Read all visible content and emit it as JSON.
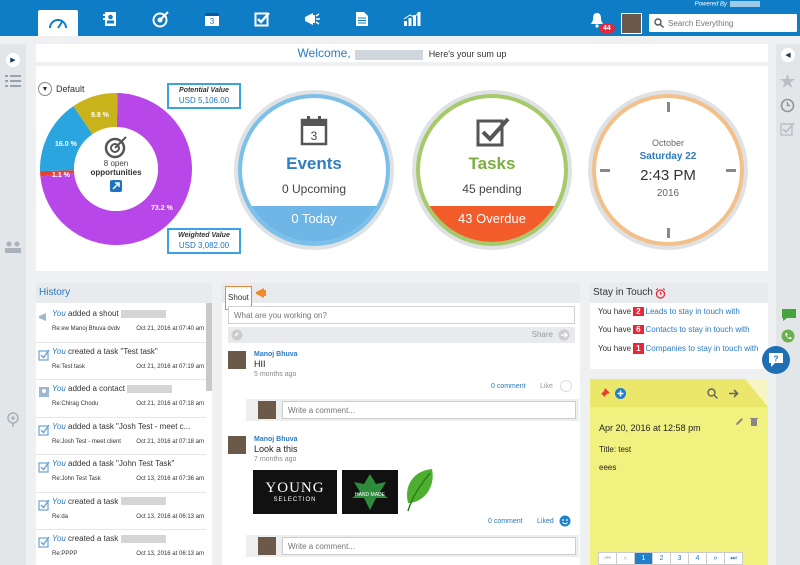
{
  "topbar": {
    "powered_by": "Powered By",
    "notification_count": "44",
    "search_placeholder": "Search Everything"
  },
  "welcome": {
    "greeting": "Welcome,",
    "sub": "Here's your sum up"
  },
  "pipeline": {
    "selector": "Default",
    "center_count": "8 open",
    "center_label": "opportunities",
    "potential_title": "Potential Value",
    "potential_value": "USD 5,106.00",
    "weighted_title": "Weighted Value",
    "weighted_value": "USD 3,082.00",
    "slices": [
      {
        "label": "73.2 %",
        "value": 73.2,
        "color": "#b847ea"
      },
      {
        "label": "1.1 %",
        "value": 1.1,
        "color": "#e8402f"
      },
      {
        "label": "16.0 %",
        "value": 16.0,
        "color": "#2ba5e0"
      },
      {
        "label": "9.8 %",
        "value": 9.8,
        "color": "#c8b41a"
      }
    ]
  },
  "events": {
    "title": "Events",
    "upcoming": "0 Upcoming",
    "today": "0 Today",
    "calendar_day": "3"
  },
  "tasks": {
    "title": "Tasks",
    "pending": "45 pending",
    "overdue": "43 Overdue"
  },
  "clock": {
    "month": "October",
    "day": "Saturday 22",
    "time": "2:43 PM",
    "year": "2016"
  },
  "history": {
    "title": "History",
    "items": [
      {
        "you": "You",
        "action": " added a shout",
        "ref": "Re:ew Manoj Bhuva dvdv",
        "ts": "Oct 21, 2016 at 07:40 am"
      },
      {
        "you": "You",
        "action": " created a task \"Test task\"",
        "ref": "Re:Test task",
        "ts": "Oct 21, 2016 at 07:19 am"
      },
      {
        "you": "You",
        "action": " added a contact",
        "ref": "Re:Chirag Chodu",
        "ts": "Oct 21, 2016 at 07:18 am"
      },
      {
        "you": "You",
        "action": " added a task \"Josh Test - meet c...",
        "ref": "Re:Josh Test - meet client",
        "ts": "Oct 21, 2016 at 07:18 am"
      },
      {
        "you": "You",
        "action": " added a task \"John Test Task\"",
        "ref": "Re:John Test Task",
        "ts": "Oct 13, 2016 at 07:36 am"
      },
      {
        "you": "You",
        "action": " created a task",
        "ref": "Re:da",
        "ts": "Oct 13, 2016 at 06:13 am"
      },
      {
        "you": "You",
        "action": " created a task",
        "ref": "Re:PPPP",
        "ts": "Oct 13, 2016 at 06:13 am"
      }
    ]
  },
  "shout": {
    "tab": "Shout",
    "placeholder": "What are you working on?",
    "share": "Share",
    "posts": [
      {
        "author": "Manoj Bhuva",
        "text": "HII",
        "ago": "5 months ago",
        "comments": "0 comment",
        "like": "Like",
        "comment_placeholder": "Write a comment..."
      },
      {
        "author": "Manoj Bhuva",
        "text": "Look a this",
        "ago": "7 months ago",
        "comments": "0 comment",
        "like": "Liked",
        "comment_placeholder": "Write a comment..."
      }
    ],
    "image1_line1": "YOUNG",
    "image1_line2": "SELECTION",
    "image2_text": "HAND MADE"
  },
  "touch": {
    "title": "Stay in Touch",
    "prefix": "You have",
    "rows": [
      {
        "count": "2",
        "text": "Leads to stay in touch with"
      },
      {
        "count": "6",
        "text": "Contacts to stay in touch with"
      },
      {
        "count": "1",
        "text": "Companies to stay in touch with"
      }
    ]
  },
  "notes": {
    "date": "Apr 20, 2016 at 12:58 pm",
    "title": "Title: test",
    "body": "eees",
    "pages": [
      "⏮",
      "«",
      "1",
      "2",
      "3",
      "4",
      "»",
      "⏭"
    ]
  }
}
